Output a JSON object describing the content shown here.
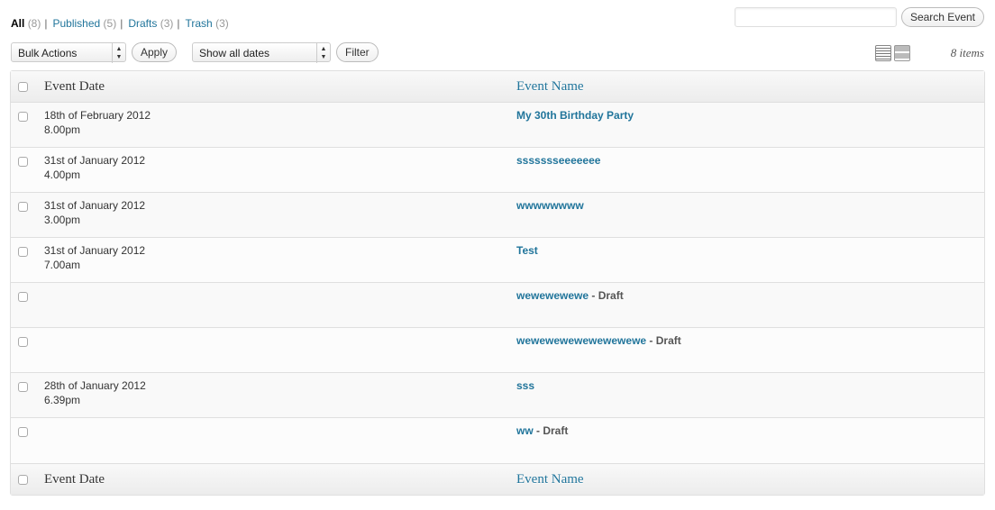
{
  "views": [
    {
      "label": "All",
      "count": "(8)",
      "current": true
    },
    {
      "label": "Published",
      "count": "(5)",
      "current": false
    },
    {
      "label": "Drafts",
      "count": "(3)",
      "current": false
    },
    {
      "label": "Trash",
      "count": "(3)",
      "current": false
    }
  ],
  "search": {
    "value": "",
    "button_label": "Search Event"
  },
  "tablenav": {
    "bulk_actions": "Bulk Actions",
    "apply_label": "Apply",
    "dates_filter": "Show all dates",
    "filter_label": "Filter",
    "view_modes": [
      "list-view-icon",
      "excerpt-view-icon"
    ],
    "items_count": "8 items"
  },
  "columns": {
    "date": "Event Date",
    "name": "Event Name"
  },
  "rows": [
    {
      "date": "18th of February 2012",
      "time": "8.00pm",
      "name": "My 30th Birthday Party",
      "state": ""
    },
    {
      "date": "31st of January 2012",
      "time": "4.00pm",
      "name": "ssssssseeeeeee",
      "state": ""
    },
    {
      "date": "31st of January 2012",
      "time": "3.00pm",
      "name": "wwwwwwww",
      "state": ""
    },
    {
      "date": "31st of January 2012",
      "time": "7.00am",
      "name": "Test",
      "state": ""
    },
    {
      "date": "",
      "time": "",
      "name": "wewewewewe",
      "state": " - Draft"
    },
    {
      "date": "",
      "time": "",
      "name": "wewewewewewewewewe",
      "state": " - Draft"
    },
    {
      "date": "28th of January 2012",
      "time": "6.39pm",
      "name": "sss",
      "state": ""
    },
    {
      "date": "",
      "time": "",
      "name": "ww",
      "state": " - Draft"
    }
  ],
  "colors": {
    "link": "#21759b",
    "border": "#dfdfdf"
  }
}
